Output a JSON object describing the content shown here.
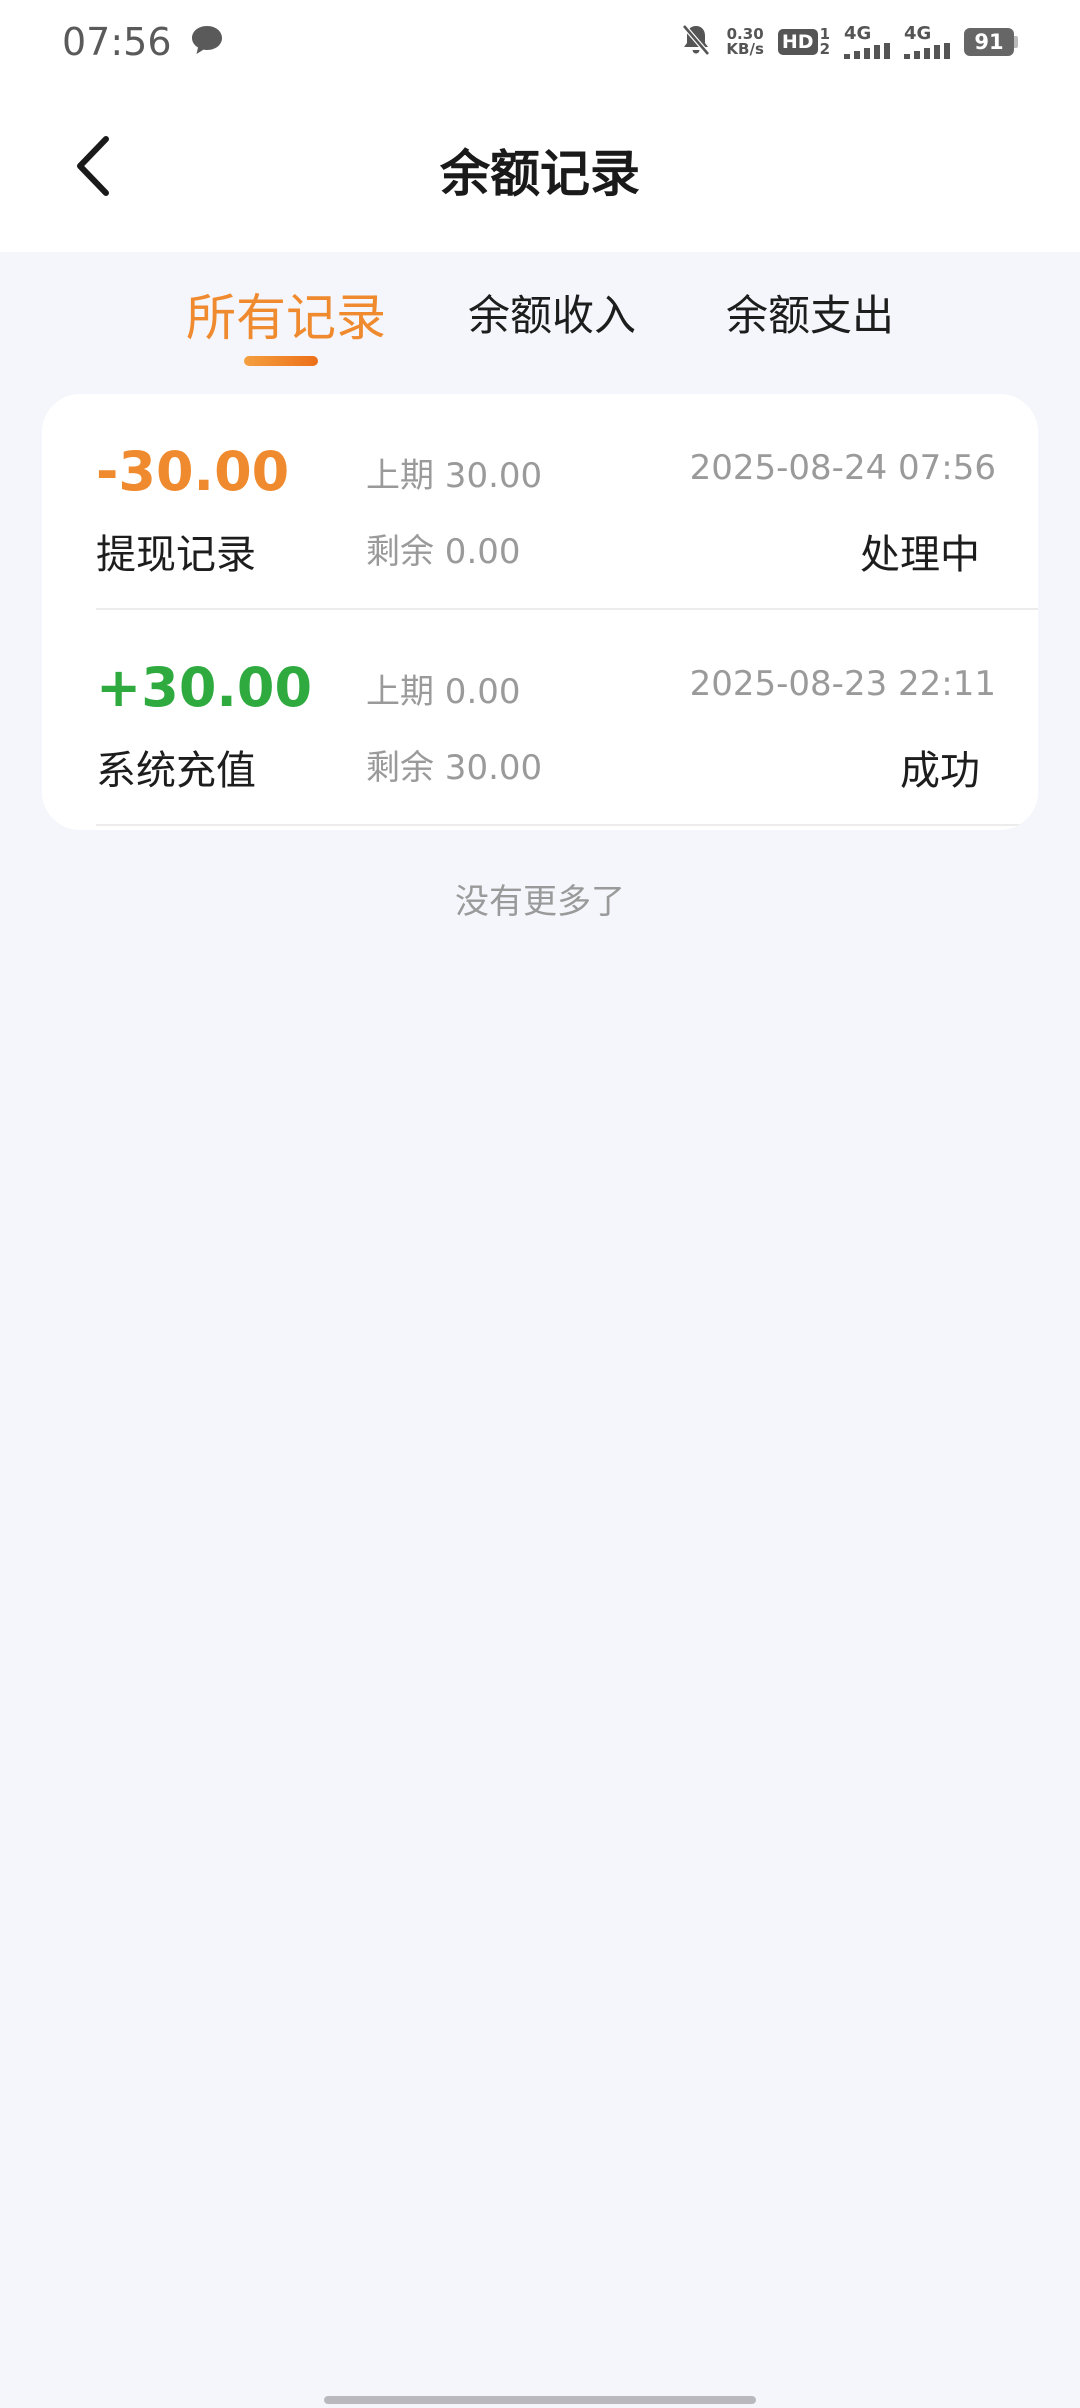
{
  "status_bar": {
    "time": "07:56",
    "net_speed_value": "0.30",
    "net_speed_unit": "KB/s",
    "hd_label": "HD",
    "hd_sub_top": "1",
    "hd_sub_bottom": "2",
    "signal1_label": "4G",
    "signal2_label": "4G",
    "battery": "91",
    "icons": [
      "message-icon",
      "bell-muted-icon",
      "hd-icon",
      "signal-icon",
      "battery-icon"
    ]
  },
  "header": {
    "title": "余额记录",
    "back_icon": "chevron-left-icon"
  },
  "tabs": [
    {
      "label": "所有记录",
      "active": true
    },
    {
      "label": "余额收入",
      "active": false
    },
    {
      "label": "余额支出",
      "active": false
    }
  ],
  "records": [
    {
      "amount": "-30.00",
      "type": "提现记录",
      "prev": "上期 30.00",
      "remain": "剩余 0.00",
      "date": "2025-08-24 07:56",
      "status": "处理中"
    },
    {
      "amount": "+30.00",
      "type": "系统充值",
      "prev": "上期 0.00",
      "remain": "剩余 30.00",
      "date": "2025-08-23 22:11",
      "status": "成功"
    }
  ],
  "footer_text": "没有更多了",
  "colors": {
    "accent": "#ef8a2e",
    "positive": "#2eaa3f",
    "background": "#f5f6fb"
  }
}
